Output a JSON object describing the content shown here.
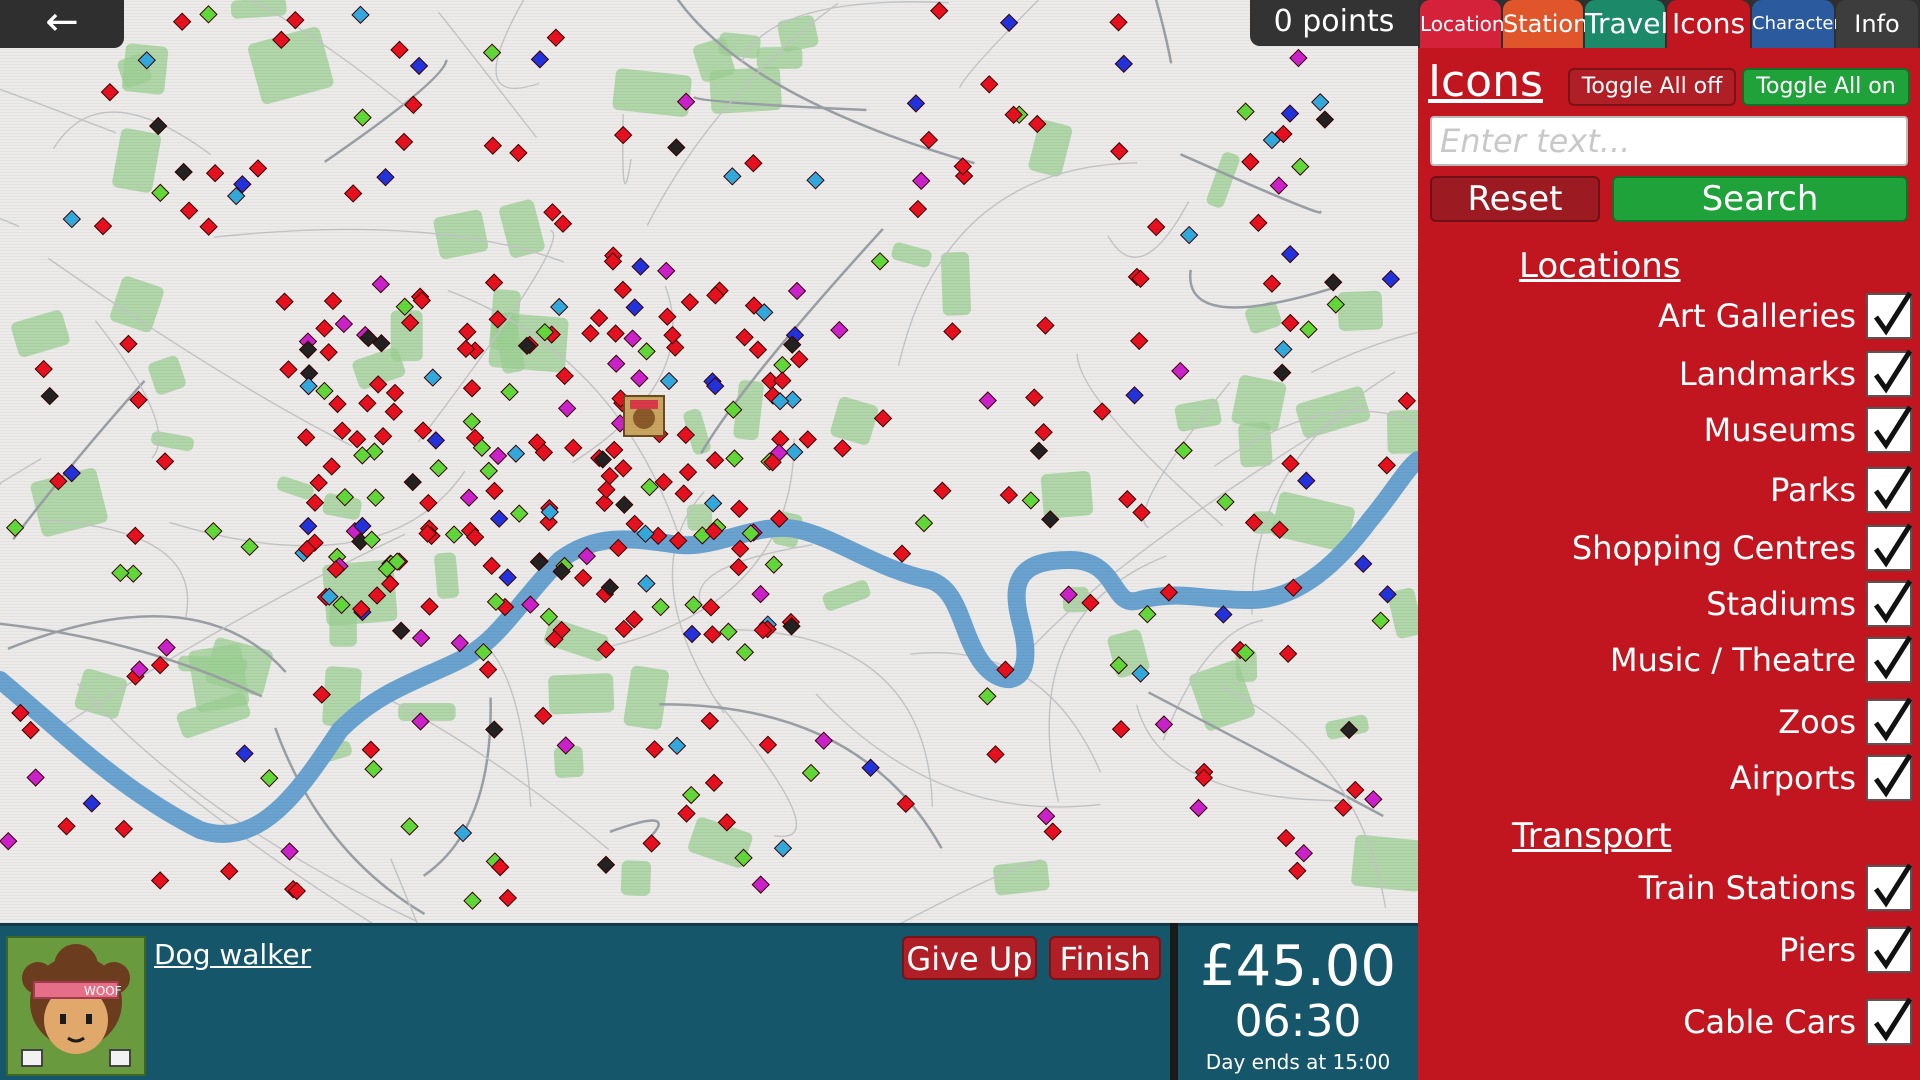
{
  "header": {
    "back_glyph": "←",
    "points": "0 points"
  },
  "tabs": [
    {
      "id": "location",
      "label": "Location"
    },
    {
      "id": "station",
      "label": "Station"
    },
    {
      "id": "travel",
      "label": "Travel"
    },
    {
      "id": "icons",
      "label": "Icons"
    },
    {
      "id": "character",
      "label": "Character"
    },
    {
      "id": "info",
      "label": "Info"
    }
  ],
  "side": {
    "heading": "Icons",
    "toggle_off": "Toggle All off",
    "toggle_on": "Toggle All on",
    "search_placeholder": "Enter text...",
    "reset": "Reset",
    "search": "Search",
    "locations_title": "Locations",
    "locations": [
      {
        "label": "Art Galleries",
        "checked": true
      },
      {
        "label": "Landmarks",
        "checked": true
      },
      {
        "label": "Museums",
        "checked": true
      },
      {
        "label": "Parks",
        "checked": true
      },
      {
        "label": "Shopping Centres",
        "checked": true
      },
      {
        "label": "Stadiums",
        "checked": true
      },
      {
        "label": "Music / Theatre",
        "checked": true
      },
      {
        "label": "Zoos",
        "checked": true
      },
      {
        "label": "Airports",
        "checked": true
      }
    ],
    "transport_title": "Transport",
    "transport": [
      {
        "label": "Train Stations",
        "checked": true
      },
      {
        "label": "Piers",
        "checked": true
      },
      {
        "label": "Cable Cars",
        "checked": true
      }
    ]
  },
  "job": {
    "title": "Dog walker",
    "give_up": "Give Up",
    "finish": "Finish",
    "avatar_badge": "WOOF"
  },
  "status": {
    "money": "£45.00",
    "time": "06:30",
    "day_ends": "Day ends at 15:00"
  },
  "colors": {
    "panel_red": "#c1161f",
    "panel_teal": "#15566b",
    "river": "#6aa3d0",
    "park": "#9ccf93",
    "marker_red": "#e8111f",
    "marker_green": "#62d93a",
    "marker_blue": "#2233dd",
    "marker_purple": "#cc22cc",
    "marker_black": "#222222",
    "marker_cyan": "#33aadd"
  }
}
